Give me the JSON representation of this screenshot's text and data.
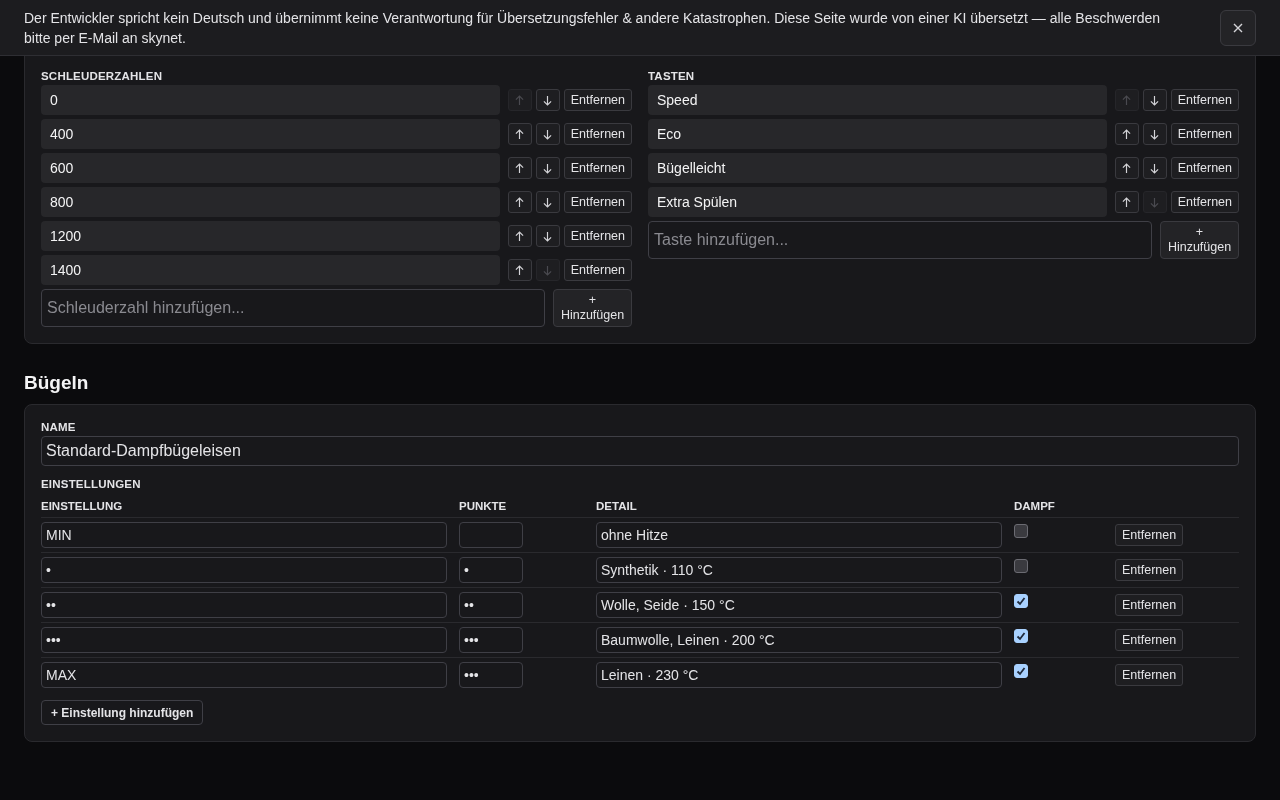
{
  "banner": {
    "message": "Der Entwickler spricht kein Deutsch und übernimmt keine Verantwortung für Übersetzungsfehler & andere Katastrophen. Diese Seite wurde von einer KI übersetzt — alle Beschwerden bitte per E-Mail an skynet."
  },
  "lists": [
    {
      "label": "SCHLEUDERZAHLEN",
      "items": [
        {
          "value": "0",
          "up_disabled": true,
          "down_disabled": false,
          "remove": "Entfernen"
        },
        {
          "value": "400",
          "up_disabled": false,
          "down_disabled": false,
          "remove": "Entfernen"
        },
        {
          "value": "600",
          "up_disabled": false,
          "down_disabled": false,
          "remove": "Entfernen"
        },
        {
          "value": "800",
          "up_disabled": false,
          "down_disabled": false,
          "remove": "Entfernen"
        },
        {
          "value": "1200",
          "up_disabled": false,
          "down_disabled": false,
          "remove": "Entfernen"
        },
        {
          "value": "1400",
          "up_disabled": false,
          "down_disabled": true,
          "remove": "Entfernen"
        }
      ],
      "add_placeholder": "Schleuderzahl hinzufügen...",
      "add_button": "+ Hinzufügen"
    },
    {
      "label": "TASTEN",
      "items": [
        {
          "value": "Speed",
          "up_disabled": true,
          "down_disabled": false,
          "remove": "Entfernen"
        },
        {
          "value": "Eco",
          "up_disabled": false,
          "down_disabled": false,
          "remove": "Entfernen"
        },
        {
          "value": "Bügelleicht",
          "up_disabled": false,
          "down_disabled": false,
          "remove": "Entfernen"
        },
        {
          "value": "Extra Spülen",
          "up_disabled": false,
          "down_disabled": true,
          "remove": "Entfernen"
        }
      ],
      "add_placeholder": "Taste hinzufügen...",
      "add_button": "+ Hinzufügen"
    }
  ],
  "ironing": {
    "title": "Bügeln",
    "name_label": "NAME",
    "name_value": "Standard-Dampfbügeleisen",
    "settings_label": "EINSTELLUNGEN",
    "columns": [
      "EINSTELLUNG",
      "PUNKTE",
      "DETAIL",
      "DAMPF"
    ],
    "rows": [
      {
        "setting": "MIN",
        "detail": "ohne Hitze",
        "steam": false,
        "remove": "Entfernen"
      },
      {
        "setting": "•",
        "dots": "•",
        "detail": "Synthetik · 110 °C",
        "steam": false,
        "remove": "Entfernen"
      },
      {
        "setting": "••",
        "dots": "••",
        "detail": "Wolle, Seide · 150 °C",
        "steam": true,
        "remove": "Entfernen"
      },
      {
        "setting": "•••",
        "dots": "•••",
        "detail": "Baumwolle, Leinen · 200 °C",
        "steam": true,
        "remove": "Entfernen"
      },
      {
        "setting": "MAX",
        "dots": "•••",
        "detail": "Leinen · 230 °C",
        "steam": true,
        "remove": "Entfernen"
      }
    ],
    "add_button": "+ Einstellung hinzufügen"
  }
}
